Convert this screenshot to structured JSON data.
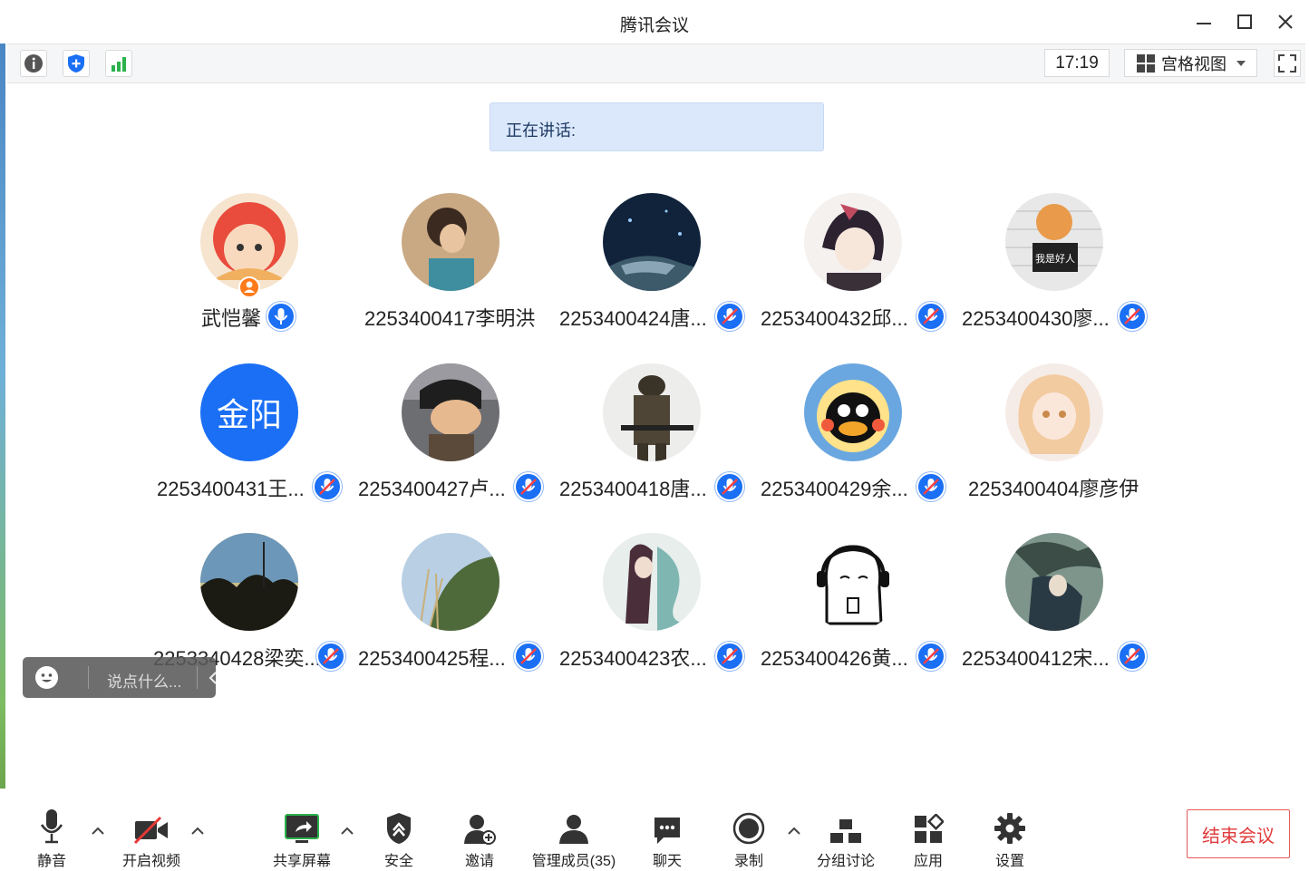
{
  "window": {
    "title": "腾讯会议"
  },
  "toolbar": {
    "time": "17:19",
    "view_mode": "宫格视图",
    "colors": {
      "info": "#555555",
      "shield": "#1a6ff5",
      "signal": "#2bb24c"
    }
  },
  "speaking": {
    "label": "正在讲话:"
  },
  "participants": [
    {
      "name": "武恺馨",
      "mic": "on"
    },
    {
      "name": "2253400417李明洪",
      "mic": "none"
    },
    {
      "name": "2253400424唐...",
      "mic": "muted"
    },
    {
      "name": "2253400432邱...",
      "mic": "muted"
    },
    {
      "name": "2253400430廖...",
      "mic": "muted"
    },
    {
      "name": "2253400431王...",
      "mic": "muted",
      "avatar_text": "金阳"
    },
    {
      "name": "2253400427卢...",
      "mic": "muted"
    },
    {
      "name": "2253400418唐...",
      "mic": "muted"
    },
    {
      "name": "2253400429余...",
      "mic": "muted"
    },
    {
      "name": "2253400404廖彦伊",
      "mic": "none"
    },
    {
      "name": "2253340428梁奕...",
      "mic": "muted"
    },
    {
      "name": "2253400425程...",
      "mic": "muted"
    },
    {
      "name": "2253400423农...",
      "mic": "muted"
    },
    {
      "name": "2253400426黄...",
      "mic": "muted"
    },
    {
      "name": "2253400412宋...",
      "mic": "muted"
    }
  ],
  "chat": {
    "placeholder": "说点什么..."
  },
  "bottom": {
    "mute": "静音",
    "video": "开启视频",
    "share": "共享屏幕",
    "security": "安全",
    "invite": "邀请",
    "members": "管理成员(35)",
    "chat": "聊天",
    "record": "录制",
    "breakout": "分组讨论",
    "apps": "应用",
    "settings": "设置",
    "end": "结束会议"
  },
  "colors": {
    "accent": "#1a6ff5",
    "end_red": "#e03c3c",
    "speaking_bg": "#dbe8fb"
  }
}
